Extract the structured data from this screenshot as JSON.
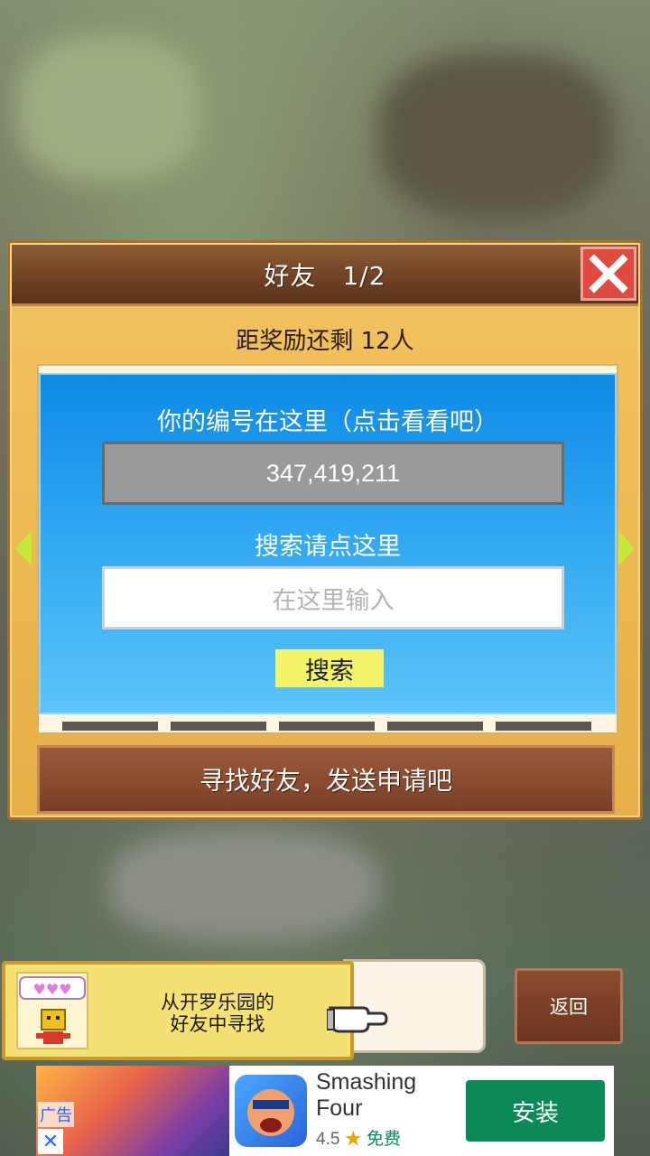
{
  "dialog": {
    "title": "好友　1/2",
    "reward_text": "距奖励还剩 12人",
    "id_label": "你的编号在这里（点击看看吧）",
    "player_id": "347,419,211",
    "search_label": "搜索请点这里",
    "search_placeholder": "在这里输入",
    "search_button": "搜索",
    "find_friends_button": "寻找好友，发送申请吧"
  },
  "bottom": {
    "kairo_text_line1": "从开罗乐园的",
    "kairo_text_line2": "好友中寻找",
    "back_button": "返回"
  },
  "ad": {
    "ad_label": "广告",
    "close": "✕",
    "app_name_line1": "Smashing",
    "app_name_line2": "Four",
    "rating": "4.5",
    "star": "★",
    "price": "免费",
    "install_button": "安装"
  },
  "colors": {
    "dialog_bg": "#f2c360",
    "title_bar": "#6e4124",
    "panel_blue": "#2fa6f2",
    "close_red": "#e04a3f",
    "search_yellow": "#f4f46a",
    "install_green": "#0b8a57"
  },
  "icons": [
    "close-icon",
    "left-arrow-icon",
    "right-arrow-icon",
    "hearts-icon",
    "robot-avatar-icon",
    "pointing-hand-icon",
    "star-icon"
  ]
}
